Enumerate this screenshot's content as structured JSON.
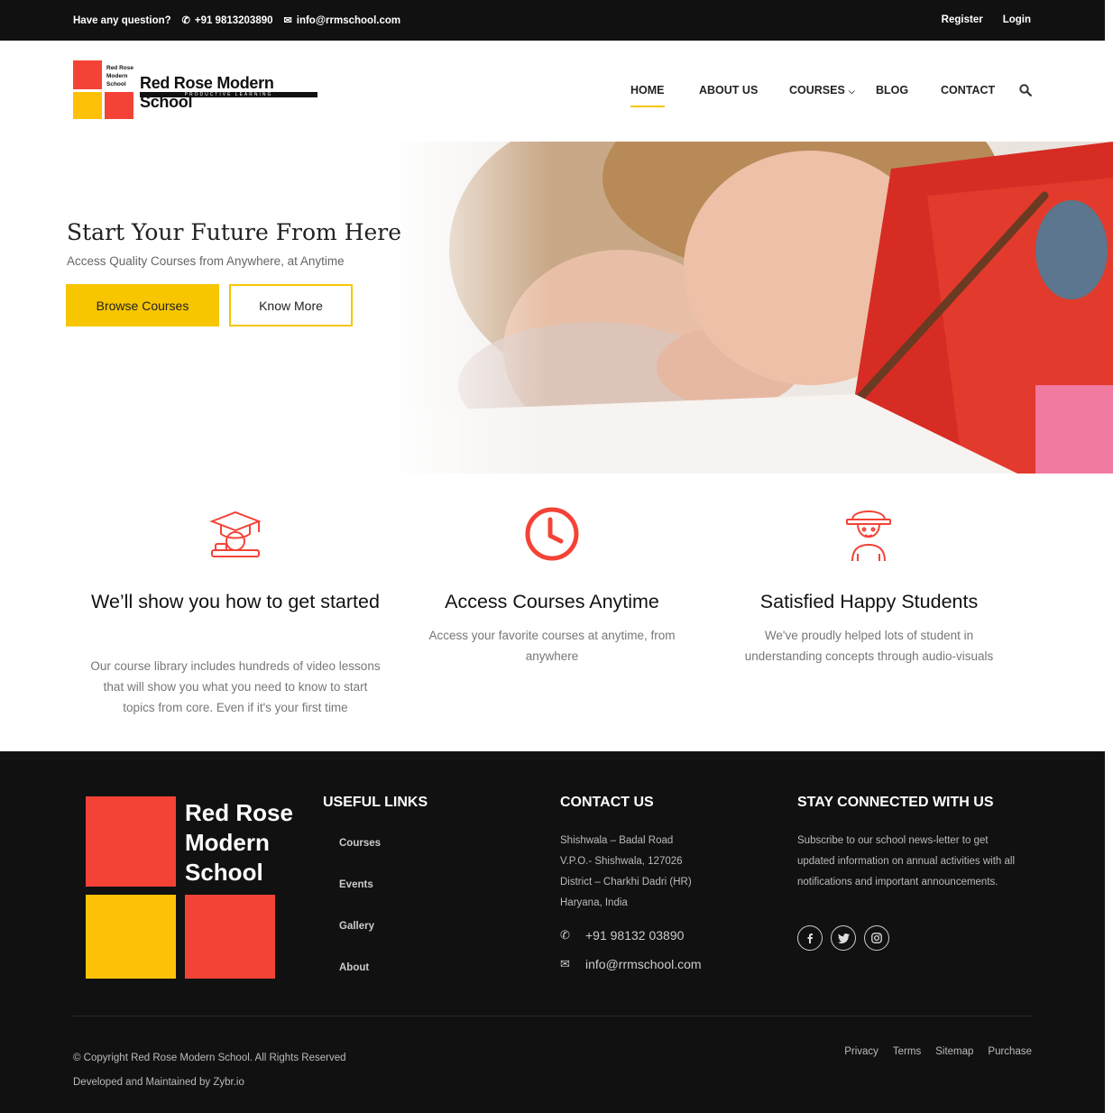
{
  "topbar": {
    "question": "Have any question?",
    "phone": "+91 9813203890",
    "email": "info@rrmschool.com",
    "register": "Register",
    "login": "Login"
  },
  "logo": {
    "small_line1": "Red Rose",
    "small_line2": "Modern",
    "small_line3": "School",
    "brand": "Red Rose Modern School",
    "tagline": "PRODUCTIVE LEARNING"
  },
  "nav": {
    "home": "HOME",
    "about": "ABOUT US",
    "courses": "COURSES",
    "blog": "BLOG",
    "contact": "CONTACT"
  },
  "hero": {
    "title": "Start Your Future From Here",
    "subtitle": "Access Quality Courses from Anywhere, at Anytime",
    "primary_button": "Browse Courses",
    "secondary_button": "Know More"
  },
  "features": [
    {
      "title": "We’ll show you how to get started",
      "text": "Our course library includes hundreds of video lessons that will show you what you need to know to start topics from core. Even if it's your first time",
      "icon": "graduation-globe-icon"
    },
    {
      "title": "Access Courses Anytime",
      "text": "Access your favorite courses at anytime, from anywhere",
      "icon": "clock-icon"
    },
    {
      "title": "Satisfied Happy Students",
      "text": "We've proudly helped lots of student in understanding concepts through audio-visuals",
      "icon": "student-icon"
    }
  ],
  "footer": {
    "logo_line1": "Red Rose",
    "logo_line2": "Modern",
    "logo_line3": "School",
    "useful_links_title": "USEFUL LINKS",
    "links": [
      "Courses",
      "Events",
      "Gallery",
      "About"
    ],
    "contact_title": "CONTACT US",
    "address": [
      "Shishwala – Badal Road",
      "V.P.O.- Shishwala, 127026",
      "District – Charkhi Dadri (HR)",
      "Haryana, India"
    ],
    "phone": "+91 98132 03890",
    "email": "info@rrmschool.com",
    "stay_title": "STAY CONNECTED WITH US",
    "stay_text": "Subscribe to our school news-letter to get updated information on annual activities with all notifications and important announcements.",
    "copyright": "© Copyright Red Rose Modern School. All Rights Reserved",
    "developed": "Developed and Maintained by Zybr.io",
    "legal": [
      "Privacy",
      "Terms",
      "Sitemap",
      "Purchase"
    ]
  },
  "colors": {
    "accent_yellow": "#f7c600",
    "brand_red": "#f44336",
    "dark": "#111111"
  }
}
